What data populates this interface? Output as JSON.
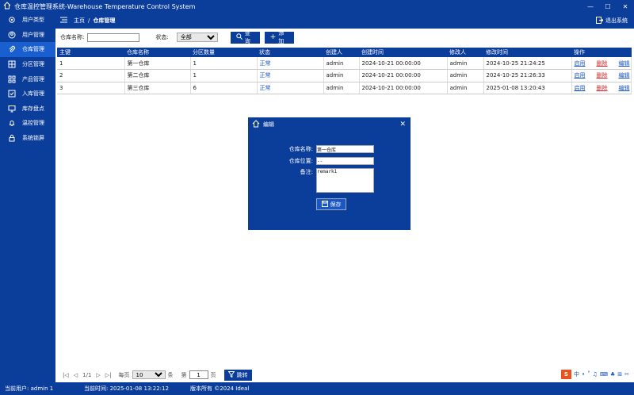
{
  "window": {
    "title": "仓库温控管理系统-Warehouse Temperature Control System",
    "min": "—",
    "max": "☐",
    "close": "✕"
  },
  "sidebar": {
    "items": [
      {
        "label": "用户类型",
        "icon": "gear-icon"
      },
      {
        "label": "用户管理",
        "icon": "user-icon"
      },
      {
        "label": "仓库管理",
        "icon": "paperclip-icon",
        "active": true
      },
      {
        "label": "分区管理",
        "icon": "partition-icon"
      },
      {
        "label": "产品管理",
        "icon": "grid-icon"
      },
      {
        "label": "入库管理",
        "icon": "checkbox-icon"
      },
      {
        "label": "库存盘点",
        "icon": "monitor-icon"
      },
      {
        "label": "温控管理",
        "icon": "bell-icon"
      },
      {
        "label": "系统锁屏",
        "icon": "lock-icon"
      }
    ]
  },
  "header": {
    "home": "主页",
    "sep": "/",
    "current": "仓库管理",
    "exit": "退出系统"
  },
  "filter": {
    "name_label": "仓库名称:",
    "name_value": "",
    "status_label": "状态:",
    "status_value": "全部",
    "query": "查询",
    "add": "添加"
  },
  "table": {
    "columns": [
      "主键",
      "仓库名称",
      "分区数量",
      "状态",
      "创建人",
      "创建时间",
      "修改人",
      "修改时间",
      "操作"
    ],
    "rows": [
      {
        "id": "1",
        "name": "第一仓库",
        "zones": "1",
        "status": "正常",
        "creator": "admin",
        "created": "2024-10-21 00:00:00",
        "modifier": "admin",
        "modified": "2024-10-25 21:24:25"
      },
      {
        "id": "2",
        "name": "第二仓库",
        "zones": "1",
        "status": "正常",
        "creator": "admin",
        "created": "2024-10-21 00:00:00",
        "modifier": "admin",
        "modified": "2024-10-25 21:26:33"
      },
      {
        "id": "3",
        "name": "第三仓库",
        "zones": "6",
        "status": "正常",
        "creator": "admin",
        "created": "2024-10-21 00:00:00",
        "modifier": "admin",
        "modified": "2025-01-08 13:20:43"
      }
    ],
    "actions": {
      "enable": "启用",
      "delete": "删除",
      "edit": "编辑"
    }
  },
  "pager": {
    "first": "|◁",
    "prev": "◁",
    "page": "1/1",
    "next": "▷",
    "last": "▷|",
    "per_page": "每页",
    "size": "10",
    "unit": "条",
    "goto_label": "第",
    "goto_value": "1",
    "goto_unit": "页",
    "jump": "跳转"
  },
  "tray": {
    "ime": "S",
    "lang": "中",
    "items": [
      "•",
      "˚",
      "♫",
      "⌨",
      "♣",
      "⊞",
      "✂"
    ]
  },
  "status": {
    "user": "当前用户:  admin 1",
    "time": "当前时间:  2025-01-08 13:22:12",
    "copyright": "版本所有 ©2024 Ideal"
  },
  "dialog": {
    "title": "编辑",
    "name_label": "仓库名称:",
    "name_value": "第一仓库",
    "location_label": "仓库位置:",
    "location_value": "--",
    "remark_label": "备注:",
    "remark_value": "remark1",
    "save": "保存"
  },
  "colors": {
    "primary": "#0b3d9a",
    "active": "#1a5fd0",
    "link": "#1a56c4",
    "danger": "#d03030"
  }
}
